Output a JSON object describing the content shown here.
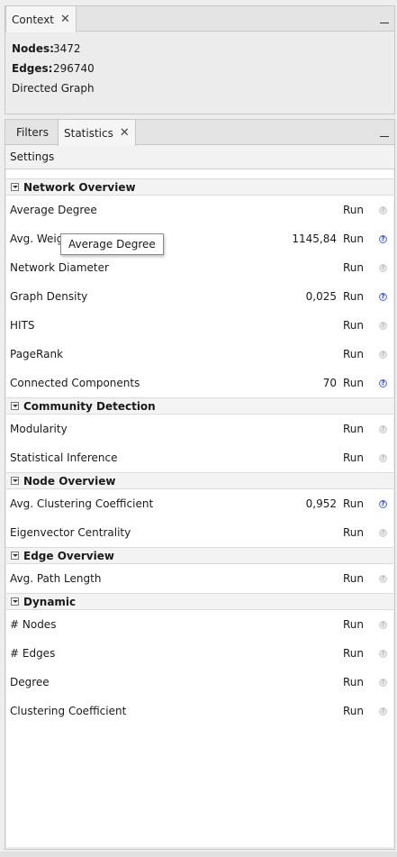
{
  "context": {
    "tab_label": "Context",
    "nodes_label": "Nodes:",
    "nodes_value": "3472",
    "edges_label": "Edges:",
    "edges_value": "296740",
    "graph_type": "Directed Graph"
  },
  "stats": {
    "tabs": [
      {
        "label": "Filters"
      },
      {
        "label": "Statistics"
      }
    ],
    "settings_label": "Settings",
    "run_label": "Run",
    "tooltip": "Average Degree",
    "sections": [
      {
        "title": "Network Overview",
        "rows": [
          {
            "name": "Average Degree",
            "value": "",
            "help_active": false
          },
          {
            "name": "Avg. Weighted Degree",
            "value": "1145,84",
            "help_active": true
          },
          {
            "name": "Network Diameter",
            "value": "",
            "help_active": false
          },
          {
            "name": "Graph Density",
            "value": "0,025",
            "help_active": true
          },
          {
            "name": "HITS",
            "value": "",
            "help_active": false
          },
          {
            "name": "PageRank",
            "value": "",
            "help_active": false
          },
          {
            "name": "Connected Components",
            "value": "70",
            "help_active": true
          }
        ]
      },
      {
        "title": "Community Detection",
        "rows": [
          {
            "name": "Modularity",
            "value": "",
            "help_active": false
          },
          {
            "name": "Statistical Inference",
            "value": "",
            "help_active": false
          }
        ]
      },
      {
        "title": "Node Overview",
        "rows": [
          {
            "name": "Avg. Clustering Coefficient",
            "value": "0,952",
            "help_active": true
          },
          {
            "name": "Eigenvector Centrality",
            "value": "",
            "help_active": false
          }
        ]
      },
      {
        "title": "Edge Overview",
        "rows": [
          {
            "name": "Avg. Path Length",
            "value": "",
            "help_active": false
          }
        ]
      },
      {
        "title": "Dynamic",
        "rows": [
          {
            "name": "# Nodes",
            "value": "",
            "help_active": false
          },
          {
            "name": "# Edges",
            "value": "",
            "help_active": false
          },
          {
            "name": "Degree",
            "value": "",
            "help_active": false
          },
          {
            "name": "Clustering Coefficient",
            "value": "",
            "help_active": false
          }
        ]
      }
    ]
  }
}
